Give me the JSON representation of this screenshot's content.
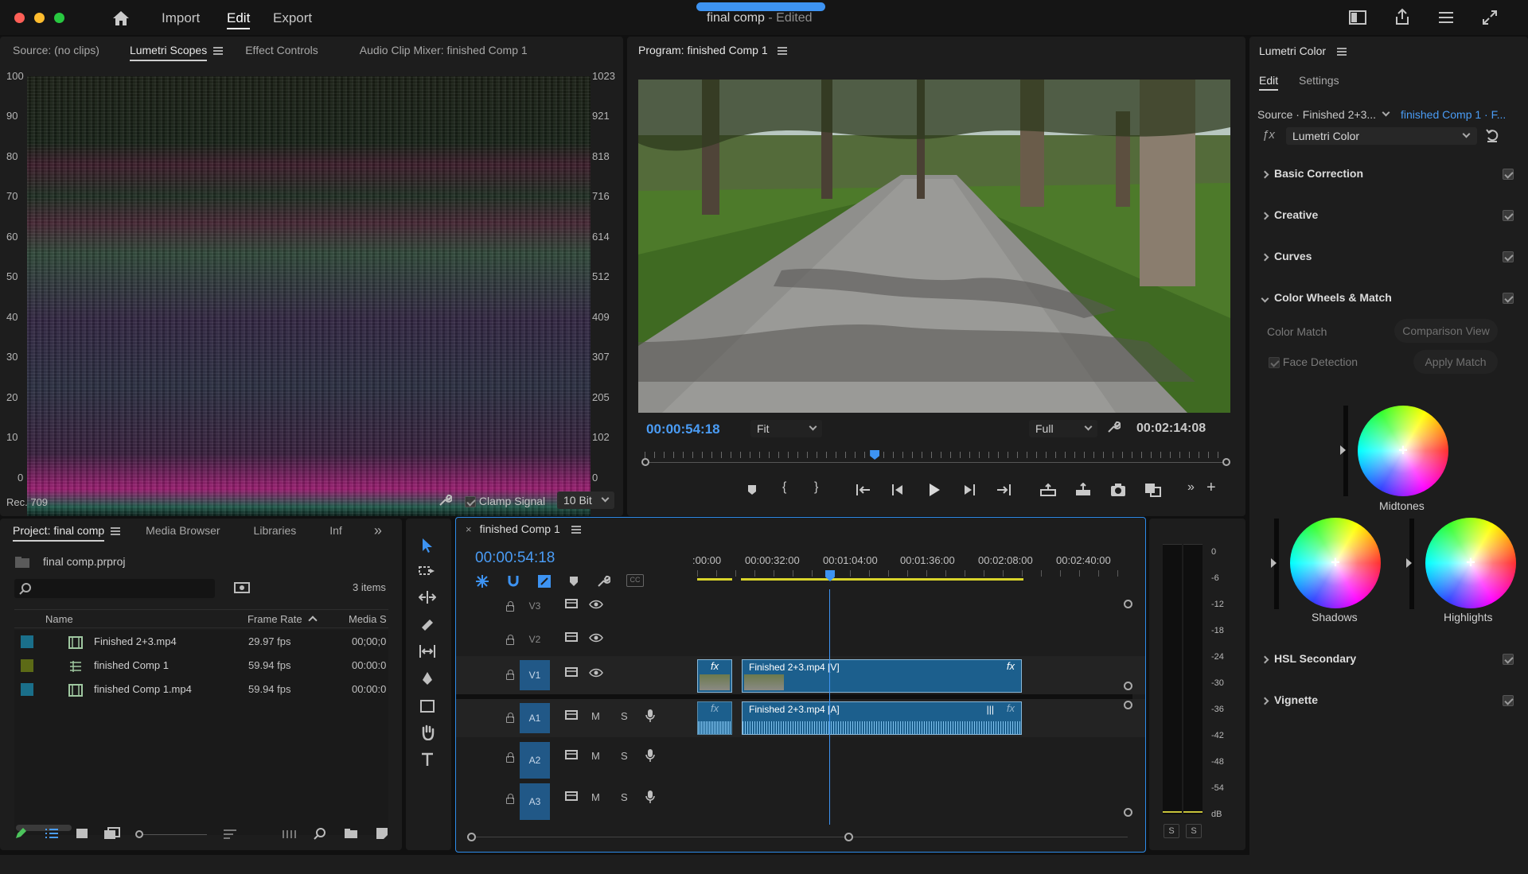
{
  "titlebar": {
    "nav": [
      "Import",
      "Edit",
      "Export"
    ],
    "active_nav": "Edit",
    "project_name": "final comp",
    "project_status": "- Edited"
  },
  "source_panel": {
    "tabs": [
      "Source: (no clips)",
      "Lumetri Scopes",
      "Effect Controls",
      "Audio Clip Mixer: finished Comp 1"
    ],
    "active_tab": "Lumetri Scopes",
    "scale_left": [
      "100",
      "90",
      "80",
      "70",
      "60",
      "50",
      "40",
      "30",
      "20",
      "10",
      "0"
    ],
    "scale_right": [
      "1023",
      "921",
      "818",
      "716",
      "614",
      "512",
      "409",
      "307",
      "205",
      "102",
      "0"
    ],
    "color_space": "Rec. 709",
    "clamp_label": "Clamp Signal",
    "clamp_checked": true,
    "bit_depth": "10 Bit"
  },
  "program_monitor": {
    "title": "Program: finished Comp 1",
    "current_time": "00:00:54:18",
    "zoom": "Fit",
    "resolution": "Full",
    "duration": "00:02:14:08",
    "playhead_position": 0.395
  },
  "lumetri": {
    "title": "Lumetri Color",
    "tabs": [
      "Edit",
      "Settings"
    ],
    "active_tab": "Edit",
    "source_label": "Source · Finished 2+3...",
    "target_label": "finished Comp 1 · F...",
    "effect": "Lumetri Color",
    "sections": [
      {
        "label": "Basic Correction",
        "enabled": true,
        "expanded": false
      },
      {
        "label": "Creative",
        "enabled": true,
        "expanded": false
      },
      {
        "label": "Curves",
        "enabled": true,
        "expanded": false
      },
      {
        "label": "Color Wheels & Match",
        "enabled": true,
        "expanded": true
      },
      {
        "label": "HSL Secondary",
        "enabled": true,
        "expanded": false
      },
      {
        "label": "Vignette",
        "enabled": true,
        "expanded": false
      }
    ],
    "color_match": "Color Match",
    "comparison_view": "Comparison View",
    "face_detection": "Face Detection",
    "face_detection_checked": true,
    "apply_match": "Apply Match",
    "wheels": [
      "Midtones",
      "Shadows",
      "Highlights"
    ]
  },
  "project_panel": {
    "tabs": [
      "Project: final comp",
      "Media Browser",
      "Libraries",
      "Inf"
    ],
    "active_tab": "Project: final comp",
    "file": "final comp.prproj",
    "item_count": "3 items",
    "columns": [
      "Name",
      "Frame Rate",
      "Media S"
    ],
    "items": [
      {
        "name": "Finished 2+3.mp4",
        "rate": "29.97 fps",
        "media": "00;00;0",
        "color": "#1a6f8a",
        "kind": "clip"
      },
      {
        "name": "finished Comp 1",
        "rate": "59.94 fps",
        "media": "00:00:0",
        "color": "#5c6a16",
        "kind": "sequence"
      },
      {
        "name": "finished Comp 1.mp4",
        "rate": "59.94 fps",
        "media": "00:00:0",
        "color": "#1a6f8a",
        "kind": "clip"
      }
    ]
  },
  "timeline": {
    "sequence_name": "finished Comp 1",
    "current_time": "00:00:54:18",
    "ruler": [
      ":00:00",
      "00:00:32:00",
      "00:01:04:00",
      "00:01:36:00",
      "00:02:08:00",
      "00:02:40:00"
    ],
    "tracks": [
      {
        "id": "V3",
        "kind": "video",
        "targeted": false
      },
      {
        "id": "V2",
        "kind": "video",
        "targeted": false
      },
      {
        "id": "V1",
        "kind": "video",
        "targeted": true
      },
      {
        "id": "A1",
        "kind": "audio",
        "targeted": true
      },
      {
        "id": "A2",
        "kind": "audio",
        "targeted": true
      },
      {
        "id": "A3",
        "kind": "audio",
        "targeted": true
      }
    ],
    "mute_label": "M",
    "solo_label": "S",
    "fx_label": "fx",
    "clips": {
      "video": "Finished 2+3.mp4 [V]",
      "audio": "Finished 2+3.mp4 [A]"
    }
  },
  "audio_meter": {
    "scale": [
      "0",
      "-6",
      "-12",
      "-18",
      "-24",
      "-30",
      "-36",
      "-42",
      "-48",
      "-54",
      "dB"
    ],
    "solo_buttons": [
      "S",
      "S"
    ]
  },
  "colors": {
    "accent": "#2d8ceb",
    "track_target": "#215887",
    "clip_video": "#1c5f8d",
    "timecode": "#4a9cf5"
  }
}
